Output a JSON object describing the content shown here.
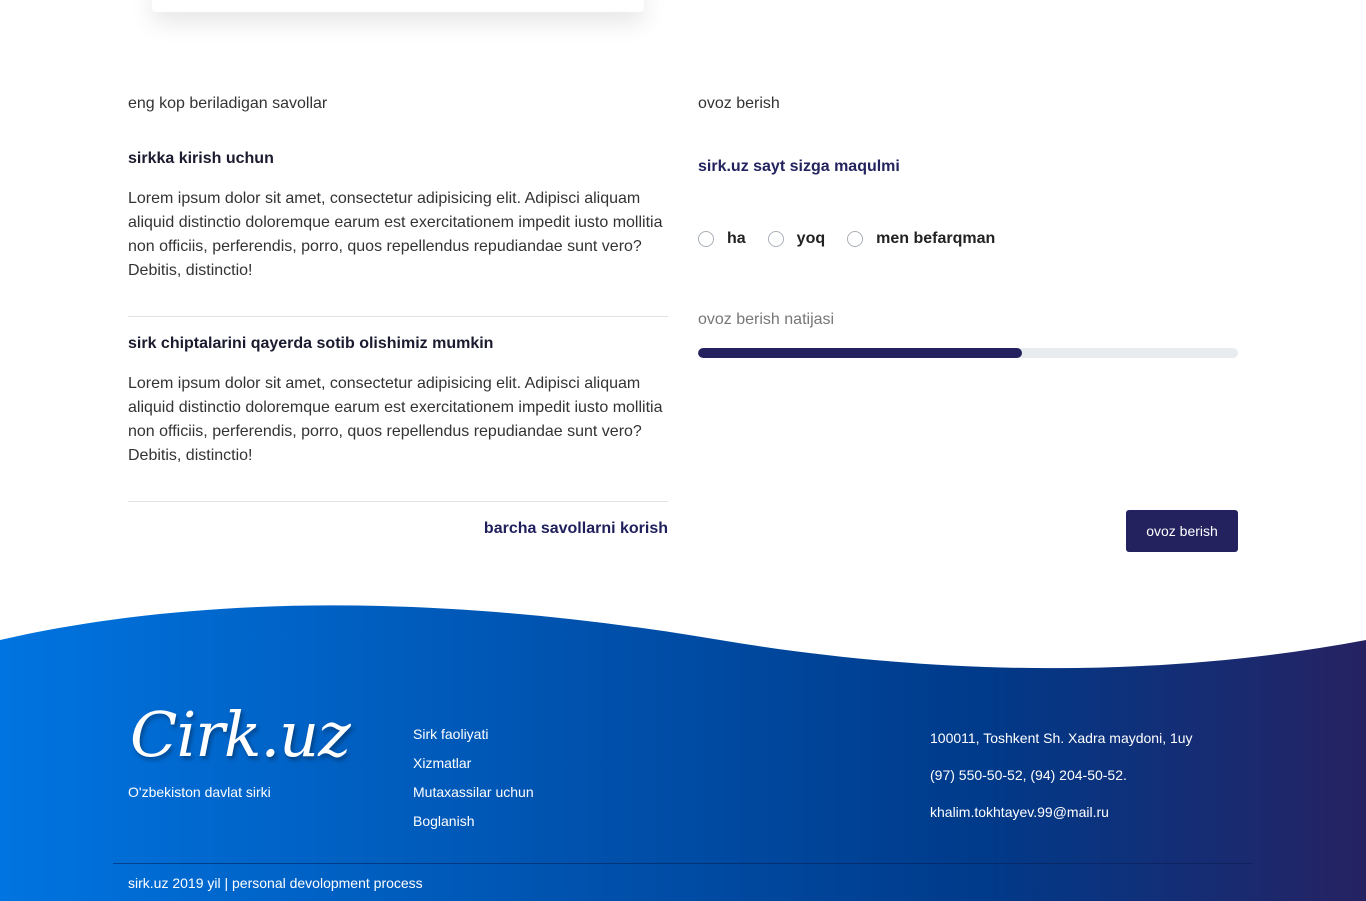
{
  "faq": {
    "section_title": "eng kop beriladigan savollar",
    "items": [
      {
        "question": "sirkka kirish uchun",
        "answer": "Lorem ipsum dolor sit amet, consectetur adipisicing elit. Adipisci aliquam aliquid distinctio doloremque earum est exercitationem impedit iusto mollitia non officiis, perferendis, porro, quos repellendus repudiandae sunt vero? Debitis, distinctio!"
      },
      {
        "question": "sirk chiptalarini qayerda sotib olishimiz mumkin",
        "answer": "Lorem ipsum dolor sit amet, consectetur adipisicing elit. Adipisci aliquam aliquid distinctio doloremque earum est exercitationem impedit iusto mollitia non officiis, perferendis, porro, quos repellendus repudiandae sunt vero? Debitis, distinctio!"
      }
    ],
    "see_all_label": "barcha savollarni korish"
  },
  "vote": {
    "section_title": "ovoz berish",
    "question": "sirk.uz sayt sizga maqulmi",
    "options": [
      "ha",
      "yoq",
      "men befarqman"
    ],
    "result_label": "ovoz berish natijasi",
    "result_percent": 60,
    "button_label": "ovoz berish"
  },
  "footer": {
    "logo_text": "Cirk.uz",
    "logo_subtitle": "O'zbekiston davlat sirki",
    "links": [
      "Sirk faoliyati",
      "Xizmatlar",
      "Mutaxassilar uchun",
      "Boglanish"
    ],
    "address": "100011, Toshkent Sh. Xadra maydoni, 1uy",
    "phones": "(97) 550-50-52, (94) 204-50-52.",
    "email": "khalim.tokhtayev.99@mail.ru",
    "copyright": "sirk.uz 2019 yil | personal devolopment process"
  },
  "colors": {
    "primary": "#23225e",
    "footer_gradient_start": "#0074e0",
    "footer_gradient_mid": "#003a8a",
    "footer_gradient_end": "#262262",
    "progress_track": "#e9ecef"
  }
}
